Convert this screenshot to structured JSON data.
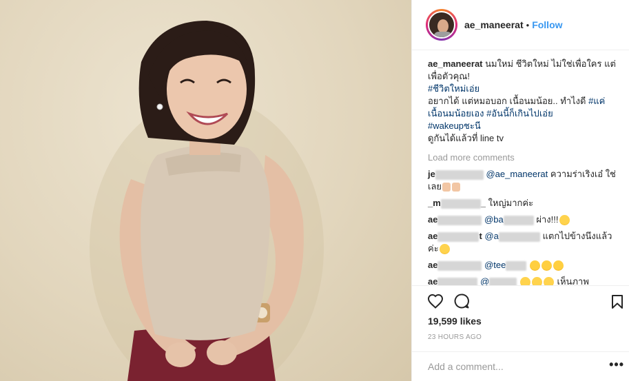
{
  "header": {
    "username": "ae_maneerat",
    "separator": "•",
    "follow_label": "Follow"
  },
  "caption": {
    "username": "ae_maneerat",
    "line1": "นมใหม่ ชีวิตใหม่ ไม่ใช่เพื่อใคร แต่เพื่อตัวคุณ!",
    "hashtag1": "#ชีวิตใหม่เอ่ย",
    "line2": "อยากได้ แต่หมอบอก เนื้อนมน้อย.. ทำไงดี",
    "hashtag2": "#แค่เนื้อนมน้อยเอง",
    "hashtag3": "#อันนี้ก็เกินไปเอ่ย",
    "hashtag4": "#wakeupชะนี",
    "line3": "ดูกันได้แล้วที่ line tv"
  },
  "load_more": "Load more comments",
  "comments": [
    {
      "user_prefix": "je",
      "mention": "@ae_maneerat",
      "text": "ความร่าเริงเอ๋ ใช่เลย"
    },
    {
      "user_prefix": "_m",
      "user_suffix": "_",
      "mention": "",
      "text": "ใหญ่มากค่ะ"
    },
    {
      "user_prefix": "ae",
      "mention": "@ba",
      "text": "ผ่าง!!!"
    },
    {
      "user_prefix": "ae",
      "user_suffix": "t",
      "mention": "@a",
      "text": "แตกไปข้างนึงแล้วค่ะ"
    },
    {
      "user_prefix": "ae",
      "mention": "@tee",
      "text": ""
    },
    {
      "user_prefix": "ae",
      "mention": "@",
      "text": "เห็นภาพ"
    }
  ],
  "actions": {
    "like_icon": "heart-icon",
    "comment_icon": "comment-icon",
    "save_icon": "bookmark-icon"
  },
  "likes": "19,599 likes",
  "timestamp": "23 HOURS AGO",
  "add_comment": {
    "placeholder": "Add a comment...",
    "more_label": "•••"
  },
  "colors": {
    "link": "#3897f0",
    "hashtag": "#003569",
    "muted": "#999999"
  }
}
